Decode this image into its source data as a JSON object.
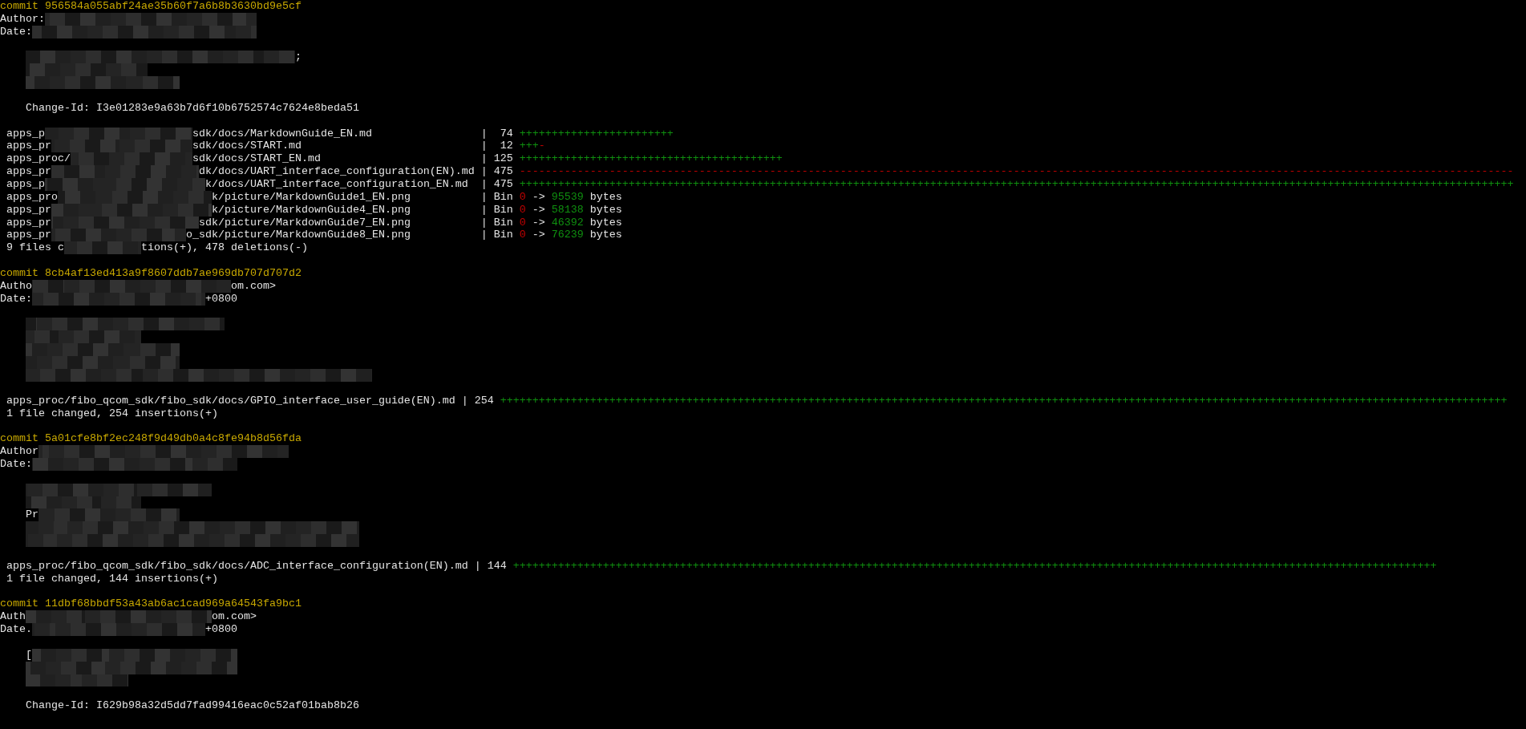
{
  "terminal": {
    "commits": [
      {
        "hash_line": "commit 956584a055abf24ae35b60f7a6b8b3630bd9e5cf",
        "header": [
          [
            {
              "kind": "plain",
              "text": "Author:"
            },
            {
              "kind": "redacted"
            }
          ],
          [
            {
              "kind": "plain",
              "text": "Date:"
            },
            {
              "kind": "redacted"
            }
          ]
        ],
        "message": [
          [
            [
              {
                "kind": "redacted"
              },
              {
                "kind": "plain",
                "text": ";"
              }
            ],
            [
              {
                "kind": "redacted"
              }
            ],
            [
              {
                "kind": "redacted"
              }
            ]
          ],
          [
            [
              {
                "kind": "plain",
                "text": "Change-Id: I3e01283e9a63b7d6f10b6752574c7624e8beda51"
              }
            ]
          ]
        ],
        "stats": [
          {
            "path": [
              {
                "kind": "plain",
                "text": "apps_p"
              },
              {
                "kind": "redacted"
              },
              {
                "kind": "plain",
                "text": "sdk/docs/MarkdownGuide_EN.md"
              }
            ],
            "separator": "|",
            "count": "74",
            "graph": [
              {
                "kind": "added",
                "text": "++++++++++++++++++++++++"
              }
            ]
          },
          {
            "path": [
              {
                "kind": "plain",
                "text": "apps_pr"
              },
              {
                "kind": "redacted"
              },
              {
                "kind": "plain",
                "text": "sdk/docs/START.md"
              }
            ],
            "separator": "|",
            "count": "12",
            "graph": [
              {
                "kind": "added",
                "text": "+++"
              },
              {
                "kind": "removed",
                "text": "-"
              }
            ]
          },
          {
            "path": [
              {
                "kind": "plain",
                "text": "apps_proc/"
              },
              {
                "kind": "redacted"
              },
              {
                "kind": "plain",
                "text": "sdk/docs/START_EN.md"
              }
            ],
            "separator": "|",
            "count": "125",
            "graph": [
              {
                "kind": "added",
                "text": "+++++++++++++++++++++++++++++++++++++++++"
              }
            ]
          },
          {
            "path": [
              {
                "kind": "plain",
                "text": "apps_pr"
              },
              {
                "kind": "redacted"
              },
              {
                "kind": "plain",
                "text": "dk/docs/UART_interface_configuration(EN).md"
              }
            ],
            "separator": "|",
            "count": "475",
            "graph": [
              {
                "kind": "removed",
                "text": "-----------------------------------------------------------------------------------------------------------------------------------------------------------"
              }
            ]
          },
          {
            "path": [
              {
                "kind": "plain",
                "text": "apps_p"
              },
              {
                "kind": "redacted"
              },
              {
                "kind": "plain",
                "text": "k/docs/UART_interface_configuration_EN.md"
              }
            ],
            "separator": "|",
            "count": "475",
            "graph": [
              {
                "kind": "added",
                "text": "+++++++++++++++++++++++++++++++++++++++++++++++++++++++++++++++++++++++++++++++++++++++++++++++++++++++++++++++++++++++++++++++++++++++++++++++++++++++++++"
              }
            ]
          },
          {
            "path": [
              {
                "kind": "plain",
                "text": "apps_pro"
              },
              {
                "kind": "redacted"
              },
              {
                "kind": "plain",
                "text": "k/picture/MarkdownGuide1_EN.png"
              }
            ],
            "separator": "|",
            "graph": [
              {
                "kind": "plain",
                "text": "Bin "
              },
              {
                "kind": "removed",
                "text": "0"
              },
              {
                "kind": "plain",
                "text": " -> "
              },
              {
                "kind": "added",
                "text": "95539"
              },
              {
                "kind": "plain",
                "text": " bytes"
              }
            ]
          },
          {
            "path": [
              {
                "kind": "plain",
                "text": "apps_pr"
              },
              {
                "kind": "redacted"
              },
              {
                "kind": "plain",
                "text": "k/picture/MarkdownGuide4_EN.png"
              }
            ],
            "separator": "|",
            "graph": [
              {
                "kind": "plain",
                "text": "Bin "
              },
              {
                "kind": "removed",
                "text": "0"
              },
              {
                "kind": "plain",
                "text": " -> "
              },
              {
                "kind": "added",
                "text": "58138"
              },
              {
                "kind": "plain",
                "text": " bytes"
              }
            ]
          },
          {
            "path": [
              {
                "kind": "plain",
                "text": "apps_pr"
              },
              {
                "kind": "redacted"
              },
              {
                "kind": "plain",
                "text": "sdk/picture/MarkdownGuide7_EN.png"
              }
            ],
            "separator": "|",
            "graph": [
              {
                "kind": "plain",
                "text": "Bin "
              },
              {
                "kind": "removed",
                "text": "0"
              },
              {
                "kind": "plain",
                "text": " -> "
              },
              {
                "kind": "added",
                "text": "46392"
              },
              {
                "kind": "plain",
                "text": " bytes"
              }
            ]
          },
          {
            "path": [
              {
                "kind": "plain",
                "text": "apps_pr"
              },
              {
                "kind": "redacted"
              },
              {
                "kind": "plain",
                "text": "o_sdk/picture/MarkdownGuide8_EN.png"
              }
            ],
            "separator": "|",
            "graph": [
              {
                "kind": "plain",
                "text": "Bin "
              },
              {
                "kind": "removed",
                "text": "0"
              },
              {
                "kind": "plain",
                "text": " -> "
              },
              {
                "kind": "added",
                "text": "76239"
              },
              {
                "kind": "plain",
                "text": " bytes"
              }
            ]
          }
        ],
        "summary": [
          {
            "kind": "plain",
            "text": "9 files c"
          },
          {
            "kind": "redacted"
          },
          {
            "kind": "plain",
            "text": "tions(+), 478 deletions(-)"
          }
        ]
      },
      {
        "hash_line": "commit 8cb4af13ed413a9f8607ddb7ae969db707d707d2",
        "header": [
          [
            {
              "kind": "plain",
              "text": "Autho"
            },
            {
              "kind": "redacted"
            },
            {
              "kind": "plain",
              "text": "om.com>"
            }
          ],
          [
            {
              "kind": "plain",
              "text": "Date:"
            },
            {
              "kind": "redacted"
            },
            {
              "kind": "plain",
              "text": "+0800"
            }
          ]
        ],
        "message": [
          [
            [
              {
                "kind": "redacted"
              }
            ],
            [
              {
                "kind": "redacted"
              }
            ],
            [
              {
                "kind": "redacted"
              }
            ],
            [
              {
                "kind": "redacted"
              }
            ],
            [
              {
                "kind": "redacted"
              }
            ]
          ]
        ],
        "stats": [
          {
            "path": [
              {
                "kind": "plain",
                "text": "apps_proc/fibo_qcom_sdk/fibo_sdk/docs/GPIO_interface_user_guide(EN).md"
              }
            ],
            "separator": "|",
            "count": "254",
            "graph": [
              {
                "kind": "added",
                "text": "+++++++++++++++++++++++++++++++++++++++++++++++++++++++++++++++++++++++++++++++++++++++++++++++++++++++++++++++++++++++++++++++++++++++++++++++++++++++++++++"
              }
            ]
          }
        ],
        "summary": [
          {
            "kind": "plain",
            "text": "1 file changed, 254 insertions(+)"
          }
        ]
      },
      {
        "hash_line": "commit 5a01cfe8bf2ec248f9d49db0a4c8fe94b8d56fda",
        "header": [
          [
            {
              "kind": "plain",
              "text": "Author"
            },
            {
              "kind": "redacted"
            }
          ],
          [
            {
              "kind": "plain",
              "text": "Date:"
            },
            {
              "kind": "redacted"
            }
          ]
        ],
        "message": [
          [
            [
              {
                "kind": "redacted"
              }
            ],
            [
              {
                "kind": "redacted"
              }
            ],
            [
              {
                "kind": "plain",
                "text": "Pr"
              },
              {
                "kind": "redacted"
              }
            ],
            [
              {
                "kind": "redacted"
              }
            ],
            [
              {
                "kind": "redacted"
              }
            ]
          ]
        ],
        "stats": [
          {
            "path": [
              {
                "kind": "plain",
                "text": "apps_proc/fibo_qcom_sdk/fibo_sdk/docs/ADC_interface_configuration(EN).md"
              }
            ],
            "separator": "|",
            "count": "144",
            "graph": [
              {
                "kind": "added",
                "text": "++++++++++++++++++++++++++++++++++++++++++++++++++++++++++++++++++++++++++++++++++++++++++++++++++++++++++++++++++++++++++++++++++++++++++++++++"
              }
            ]
          }
        ],
        "summary": [
          {
            "kind": "plain",
            "text": "1 file changed, 144 insertions(+)"
          }
        ]
      },
      {
        "hash_line": "commit 11dbf68bbdf53a43ab6ac1cad969a64543fa9bc1",
        "header": [
          [
            {
              "kind": "plain",
              "text": "Auth"
            },
            {
              "kind": "redacted"
            },
            {
              "kind": "plain",
              "text": "om.com>"
            }
          ],
          [
            {
              "kind": "plain",
              "text": "Date."
            },
            {
              "kind": "redacted"
            },
            {
              "kind": "plain",
              "text": "+0800"
            }
          ]
        ],
        "message": [
          [
            [
              {
                "kind": "plain",
                "text": "["
              },
              {
                "kind": "redacted"
              }
            ],
            [
              {
                "kind": "redacted"
              }
            ],
            [
              {
                "kind": "redacted"
              }
            ]
          ],
          [
            [
              {
                "kind": "plain",
                "text": "Change-Id: I629b98a32d5dd7fad99416eac0c52af01bab8b26"
              }
            ]
          ]
        ]
      }
    ]
  }
}
